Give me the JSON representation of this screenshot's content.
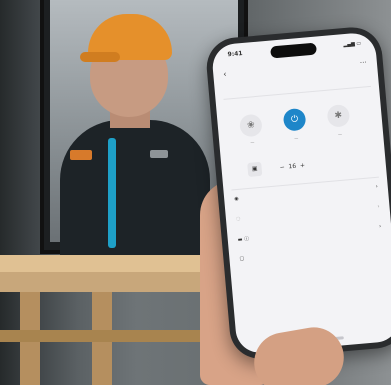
{
  "photo": {
    "description_icons": {
      "back": "‹",
      "more": "⋯",
      "fan_icon": "❀",
      "power_icon": "⏻",
      "snow_icon": "✱",
      "stepper_minus": "−",
      "stepper_plus": "+",
      "info_icon": "ⓘ",
      "chevron": "›"
    }
  },
  "phone_screen": {
    "status_time": "9:41",
    "mode_stepper_value": "16"
  }
}
